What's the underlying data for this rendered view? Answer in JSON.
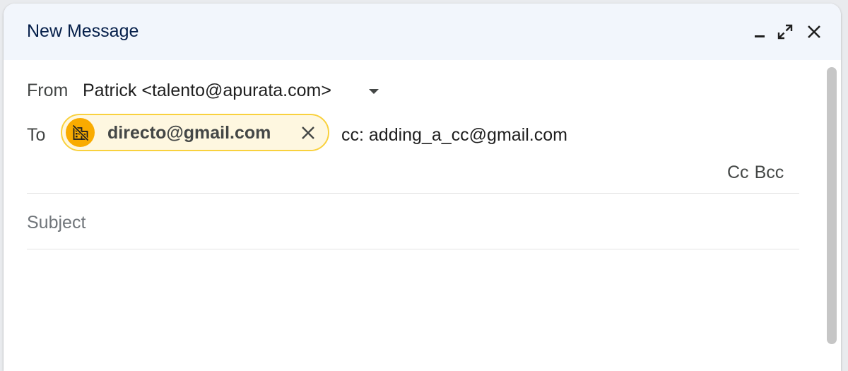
{
  "window": {
    "title": "New Message",
    "controls": {
      "minimize_icon": "minimize-icon",
      "fullscreen_icon": "expand-icon",
      "close_icon": "close-icon"
    }
  },
  "from": {
    "label": "From",
    "value": "Patrick <talento@apurata.com>",
    "dropdown_icon": "caret-down-icon"
  },
  "to": {
    "label": "To",
    "recipients": [
      {
        "email": "directo@gmail.com",
        "avatar_icon": "no-domain-icon",
        "avatar_color": "#f9ab00",
        "chip_background": "#fef7e0",
        "chip_border": "#f9d13e"
      }
    ],
    "input_value": "cc: adding_a_cc@gmail.com"
  },
  "cc_bcc": {
    "cc_label": "Cc",
    "bcc_label": "Bcc"
  },
  "subject": {
    "placeholder": "Subject",
    "value": ""
  },
  "colors": {
    "header_bg": "#f2f6fc",
    "title_color": "#041e49",
    "accent_warning": "#f9ab00"
  }
}
